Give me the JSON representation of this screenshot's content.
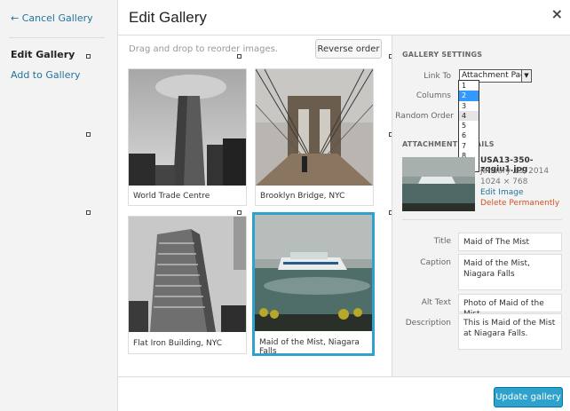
{
  "menu": {
    "cancel_label": "← Cancel Gallery",
    "active_item": "Edit Gallery",
    "add_item": "Add to Gallery"
  },
  "header": {
    "title": "Edit Gallery",
    "close": "×"
  },
  "content": {
    "drag_hint": "Drag and drop to reorder images.",
    "reverse_label": "Reverse order",
    "thumbnails": [
      {
        "caption": "World Trade Centre"
      },
      {
        "caption": "Brooklyn Bridge, NYC"
      },
      {
        "caption": "Flat Iron Building, NYC"
      },
      {
        "caption": "Maid of the Mist, Niagara Falls"
      }
    ]
  },
  "settings": {
    "title": "GALLERY SETTINGS",
    "link_to_label": "Link To",
    "link_to_value": "Attachment Page",
    "columns_label": "Columns",
    "random_label": "Random Order",
    "column_options": [
      "1",
      "2",
      "3",
      "4",
      "5",
      "6",
      "7",
      "8",
      "9"
    ],
    "selected_column": "2"
  },
  "attachment": {
    "title": "ATTACHMENT DETAILS",
    "filename": "USA13-350-zqgiu1.jpg",
    "date": "January 13, 2014",
    "dimensions": "1024 × 768",
    "edit_label": "Edit Image",
    "delete_label": "Delete Permanently",
    "fields": {
      "title_label": "Title",
      "title_value": "Maid of The Mist",
      "caption_label": "Caption",
      "caption_value": "Maid of the Mist, Niagara Falls",
      "alt_label": "Alt Text",
      "alt_value": "Photo of Maid of the Mist",
      "description_label": "Description",
      "description_value": "This is Maid of the Mist at Niagara Falls."
    }
  },
  "footer": {
    "update_label": "Update gallery"
  },
  "colors": {
    "accent": "#2ea2cc",
    "link": "#21759b",
    "delete": "#d54e21"
  }
}
